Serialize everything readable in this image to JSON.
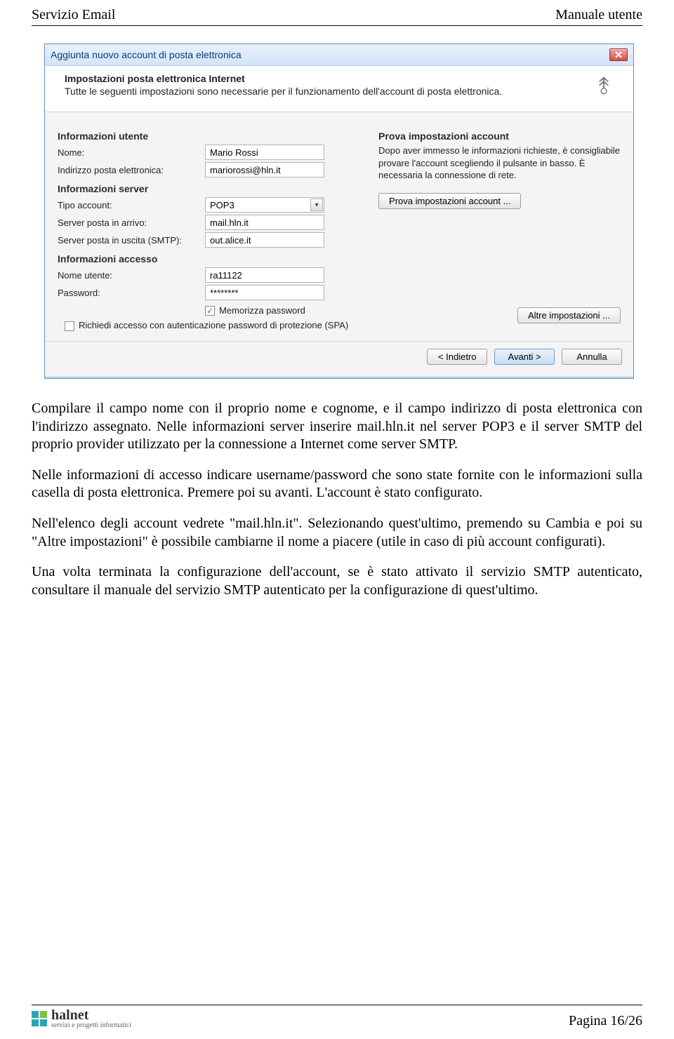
{
  "doc": {
    "header_left": "Servizio Email",
    "header_right": "Manuale utente",
    "page_label": "Pagina 16/26",
    "logo_brand": "halnet",
    "logo_tag": "servizi e progetti informatici"
  },
  "dialog": {
    "title": "Aggiunta nuovo account di posta elettronica",
    "banner_title": "Impostazioni posta elettronica Internet",
    "banner_sub": "Tutte le seguenti impostazioni sono necessarie per il funzionamento dell'account di posta elettronica.",
    "left": {
      "user_head": "Informazioni utente",
      "name_label": "Nome:",
      "name_value": "Mario Rossi",
      "email_label": "Indirizzo posta elettronica:",
      "email_value": "mariorossi@hln.it",
      "server_head": "Informazioni server",
      "acct_type_label": "Tipo account:",
      "acct_type_value": "POP3",
      "in_server_label": "Server posta in arrivo:",
      "in_server_value": "mail.hln.it",
      "out_server_label": "Server posta in uscita (SMTP):",
      "out_server_value": "out.alice.it",
      "access_head": "Informazioni accesso",
      "user_label": "Nome utente:",
      "user_value": "ra11122",
      "pass_label": "Password:",
      "pass_value": "********",
      "remember_label": "Memorizza password",
      "spa_label": "Richiedi accesso con autenticazione password di protezione (SPA)"
    },
    "right": {
      "head": "Prova impostazioni account",
      "desc": "Dopo aver immesso le informazioni richieste, è consigliabile provare l'account scegliendo il pulsante in basso. È necessaria la connessione di rete.",
      "test_btn": "Prova impostazioni account ...",
      "more_btn": "Altre impostazioni ..."
    },
    "footer": {
      "back": "< Indietro",
      "next": "Avanti >",
      "cancel": "Annulla"
    }
  },
  "paragraphs": {
    "p1": "Compilare il campo nome con il proprio nome e cognome, e il campo indirizzo di posta elettronica con l'indirizzo assegnato. Nelle informazioni server inserire mail.hln.it nel server POP3 e il server SMTP del proprio provider utilizzato per la connessione a Internet come server SMTP.",
    "p2": "Nelle informazioni di accesso indicare username/password che sono state fornite con le informazioni sulla casella di posta elettronica. Premere poi su avanti. L'account è stato configurato.",
    "p3": "Nell'elenco degli account vedrete \"mail.hln.it\". Selezionando quest'ultimo, premendo su Cambia e poi su \"Altre impostazioni\" è possibile cambiarne il nome a piacere (utile in caso di più account configurati).",
    "p4": "Una volta terminata la configurazione dell'account, se è stato attivato il servizio SMTP autenticato, consultare il manuale del servizio SMTP autenticato per la configurazione di quest'ultimo."
  }
}
